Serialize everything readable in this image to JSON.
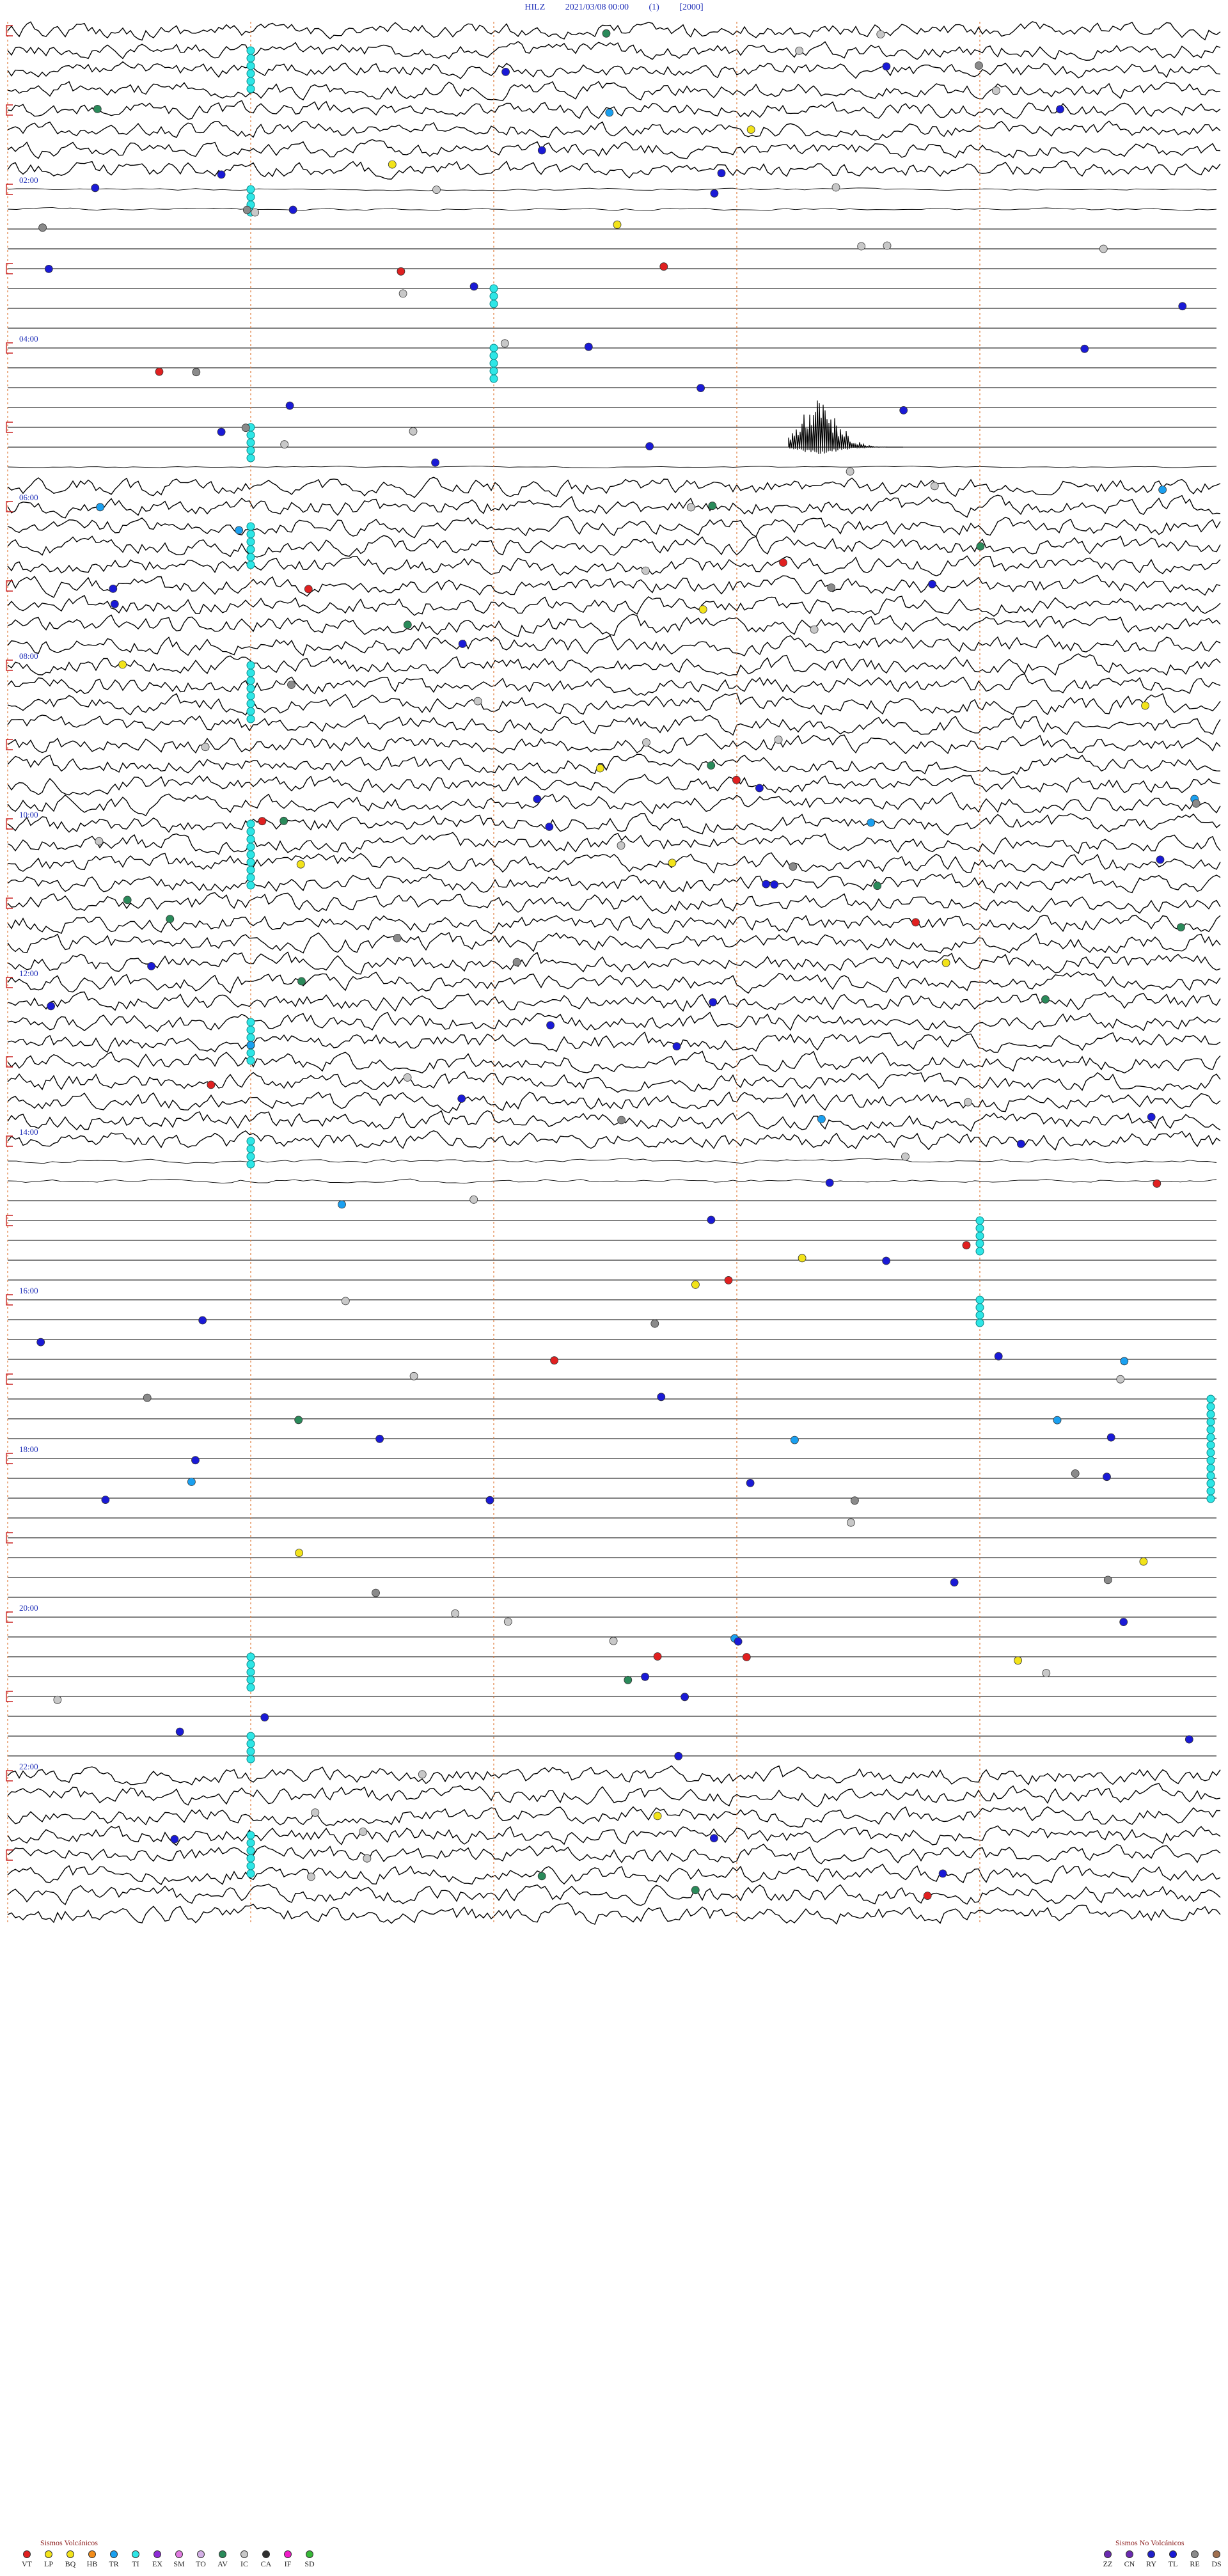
{
  "header": {
    "station": "HILZ",
    "datetime": "2021/03/08 00:00",
    "component": "(1)",
    "gain": "[2000]"
  },
  "chart_data": {
    "type": "helicorder",
    "rows": 96,
    "hour_labels": [
      "02:00",
      "04:00",
      "06:00",
      "08:00",
      "10:00",
      "12:00",
      "14:00",
      "16:00",
      "18:00",
      "20:00",
      "22:00"
    ],
    "noise_rows": [
      {
        "from": 0,
        "to": 7,
        "level": 0.9
      },
      {
        "from": 8,
        "to": 9,
        "level": 0.15
      },
      {
        "from": 22,
        "to": 22,
        "level": 0.08
      },
      {
        "from": 23,
        "to": 56,
        "level": 1.0
      },
      {
        "from": 57,
        "to": 58,
        "level": 0.25
      },
      {
        "from": 88,
        "to": 95,
        "level": 1.0
      }
    ],
    "marker_columns": [
      0.2,
      0.4,
      0.6,
      0.8
    ],
    "event_bands": [
      {
        "row": 1,
        "col": 0.2,
        "count": 6
      },
      {
        "row": 8,
        "col": 0.2,
        "count": 4
      },
      {
        "row": 13,
        "col": 0.4,
        "count": 3
      },
      {
        "row": 16,
        "col": 0.4,
        "count": 5
      },
      {
        "row": 20,
        "col": 0.2,
        "count": 5
      },
      {
        "row": 25,
        "col": 0.2,
        "count": 6
      },
      {
        "row": 32,
        "col": 0.2,
        "count": 8
      },
      {
        "row": 40,
        "col": 0.2,
        "count": 9
      },
      {
        "row": 50,
        "col": 0.2,
        "count": 6
      },
      {
        "row": 56,
        "col": 0.2,
        "count": 4
      },
      {
        "row": 60,
        "col": 0.8,
        "count": 5
      },
      {
        "row": 64,
        "col": 0.8,
        "count": 4
      },
      {
        "row": 69,
        "col": 0.99,
        "count": 14
      },
      {
        "row": 82,
        "col": 0.2,
        "count": 5
      },
      {
        "row": 86,
        "col": 0.2,
        "count": 4
      },
      {
        "row": 91,
        "col": 0.2,
        "count": 6
      }
    ],
    "burst": {
      "row": 21,
      "col": 0.69,
      "height": 0.9
    },
    "event_counts": {
      "VT": 14,
      "TR": 160,
      "IC": 90,
      "TL": 150,
      "AV": 5,
      "ZZ": 10
    }
  },
  "legend_volcanic": {
    "title": "Sismos Volcánicos",
    "items": [
      {
        "code": "VT",
        "color": "#e02020"
      },
      {
        "code": "LP",
        "color": "#f2e31a"
      },
      {
        "code": "BQ",
        "color": "#f2e31a"
      },
      {
        "code": "HB",
        "color": "#f28c1a"
      },
      {
        "code": "TR",
        "color": "#1aa0f0"
      },
      {
        "code": "TI",
        "color": "#2ee6e6"
      },
      {
        "code": "EX",
        "color": "#8e2bd6"
      },
      {
        "code": "SM",
        "color": "#e07ae0"
      },
      {
        "code": "TO",
        "color": "#d4b0e6"
      },
      {
        "code": "AV",
        "color": "#2a8a5a"
      },
      {
        "code": "IC",
        "color": "#c8c8c8"
      },
      {
        "code": "CA",
        "color": "#303030"
      },
      {
        "code": "IF",
        "color": "#f01ac8"
      },
      {
        "code": "SD",
        "color": "#38b838"
      }
    ]
  },
  "legend_nonvolcanic": {
    "title": "Sismos No Volcánicos",
    "items": [
      {
        "code": "ZZ",
        "color": "#6a2ab0"
      },
      {
        "code": "CN",
        "color": "#6a2ab0"
      },
      {
        "code": "RY",
        "color": "#2020c8"
      },
      {
        "code": "TL",
        "color": "#1a1ad6"
      },
      {
        "code": "RE",
        "color": "#8a8a8a"
      },
      {
        "code": "DS",
        "color": "#a07050"
      }
    ]
  },
  "colors": {
    "trace": "#000000",
    "label": "#1f2fb8",
    "minute_marker": "#e07a3a",
    "bracket": "#c82020",
    "event": "#2ee6e6"
  }
}
